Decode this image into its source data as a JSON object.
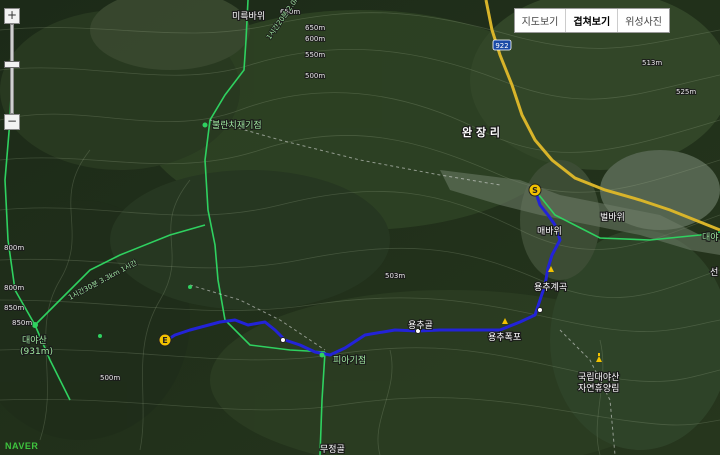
{
  "map_type": {
    "options": [
      "지도보기",
      "겹쳐보기",
      "위성사진"
    ],
    "active_index": 1
  },
  "zoom": {
    "plus": "+",
    "minus": "−",
    "level_fraction": 0.45
  },
  "places": {
    "mireukbawi": "미륵바위",
    "bulranchi": "불란치재기점",
    "wanjangri": "완 장 리",
    "maebawi": "매바위",
    "yongchu_gyegok": "용추계곡",
    "yongchugol": "용추골",
    "yongchu_pokpo": "용추폭포",
    "daeyasan_1": "대야산",
    "daeyasan_2": "(931m)",
    "park_1": "국립대야산",
    "park_2": "자연휴양림",
    "beolbawi": "벌바위",
    "pi_gijeom": "피아기점",
    "mujeonggol": "무정골",
    "right_cut": "대야",
    "right_cut2": "선"
  },
  "elevations": [
    "650m",
    "600m",
    "550m",
    "500m",
    "513m",
    "525m",
    "503m",
    "800m",
    "850m",
    "850m",
    "800m",
    "650m",
    "500m"
  ],
  "trail_labels": [
    "1시간20분 2.0km 1시간",
    "1시간30분 3.3km 1시간"
  ],
  "road_number": "922",
  "markers": {
    "start": "S",
    "end": "E"
  },
  "logo": "NAVER"
}
